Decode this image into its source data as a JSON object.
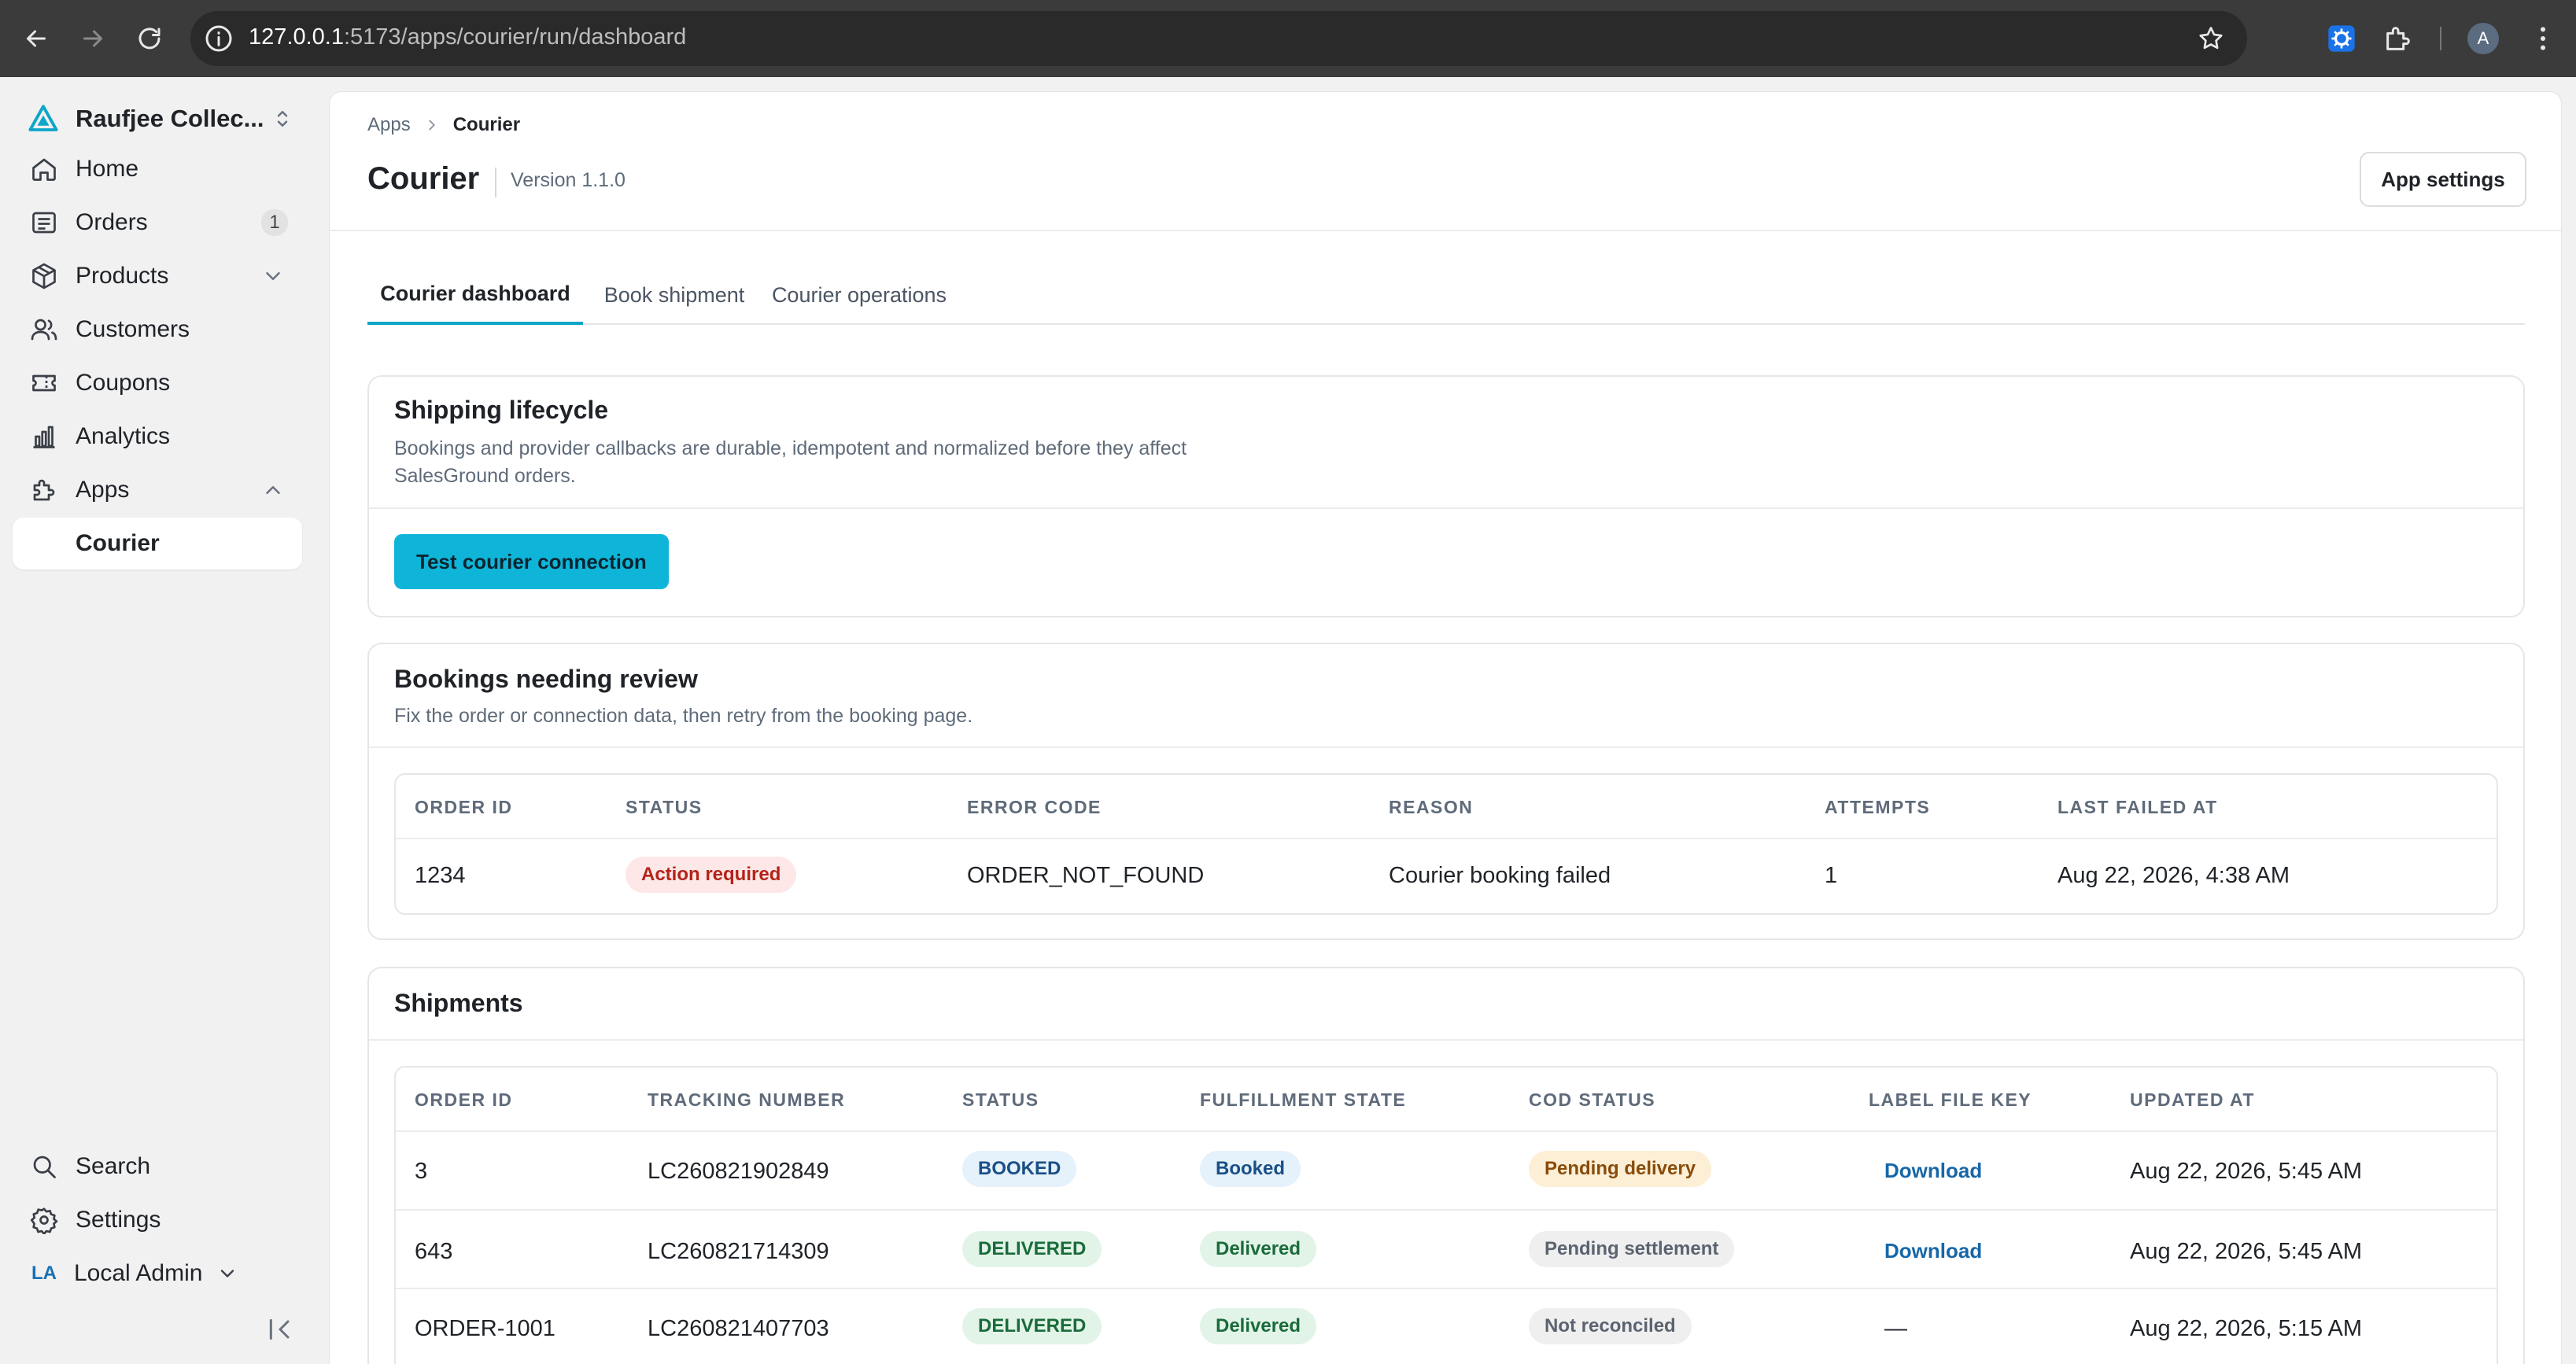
{
  "browser": {
    "url_host": "127.0.0.1",
    "url_rest": ":5173/apps/courier/run/dashboard",
    "profile_initial": "A"
  },
  "sidebar": {
    "org_name": "Raufjee Collec...",
    "items": [
      {
        "label": "Home",
        "icon": "home-icon"
      },
      {
        "label": "Orders",
        "icon": "orders-icon",
        "badge": "1"
      },
      {
        "label": "Products",
        "icon": "box-icon"
      },
      {
        "label": "Customers",
        "icon": "users-icon"
      },
      {
        "label": "Coupons",
        "icon": "ticket-icon"
      },
      {
        "label": "Analytics",
        "icon": "chart-icon"
      },
      {
        "label": "Apps",
        "icon": "puzzle-icon"
      }
    ],
    "sub_item": "Courier",
    "bottom": {
      "search": "Search",
      "settings": "Settings",
      "user_initials": "LA",
      "user_name": "Local Admin"
    }
  },
  "header": {
    "breadcrumb": [
      "Apps",
      "Courier"
    ],
    "title": "Courier",
    "version": "Version 1.1.0",
    "settings_button": "App settings"
  },
  "tabs": [
    "Courier dashboard",
    "Book shipment",
    "Courier operations"
  ],
  "lifecycle": {
    "title": "Shipping lifecycle",
    "description": "Bookings and provider callbacks are durable, idempotent and normalized before they affect SalesGround orders.",
    "button": "Test courier connection"
  },
  "review": {
    "title": "Bookings needing review",
    "description": "Fix the order or connection data, then retry from the booking page.",
    "columns": [
      "ORDER ID",
      "STATUS",
      "ERROR CODE",
      "REASON",
      "ATTEMPTS",
      "LAST FAILED AT"
    ],
    "rows": [
      {
        "order_id": "1234",
        "status": "Action required",
        "error_code": "ORDER_NOT_FOUND",
        "reason": "Courier booking failed",
        "attempts": "1",
        "last_failed_at": "Aug 22, 2026, 4:38 AM"
      }
    ]
  },
  "shipments": {
    "title": "Shipments",
    "columns": [
      "ORDER ID",
      "TRACKING NUMBER",
      "STATUS",
      "FULFILLMENT STATE",
      "COD STATUS",
      "LABEL FILE KEY",
      "UPDATED AT"
    ],
    "rows": [
      {
        "order_id": "3",
        "tracking": "LC260821902849",
        "status": "BOOKED",
        "fulfillment": "Booked",
        "cod": "Pending delivery",
        "label": "Download",
        "updated": "Aug 22, 2026, 5:45 AM"
      },
      {
        "order_id": "643",
        "tracking": "LC260821714309",
        "status": "DELIVERED",
        "fulfillment": "Delivered",
        "cod": "Pending settlement",
        "label": "Download",
        "updated": "Aug 22, 2026, 5:45 AM"
      },
      {
        "order_id": "ORDER-1001",
        "tracking": "LC260821407703",
        "status": "DELIVERED",
        "fulfillment": "Delivered",
        "cod": "Not reconciled",
        "label": "—",
        "updated": "Aug 22, 2026, 5:15 AM"
      }
    ]
  },
  "colors": {
    "accent": "#0fb5d8",
    "danger_bg": "#fde7e7",
    "success_bg": "#e2f4e8",
    "warning_bg": "#fcefd6"
  }
}
